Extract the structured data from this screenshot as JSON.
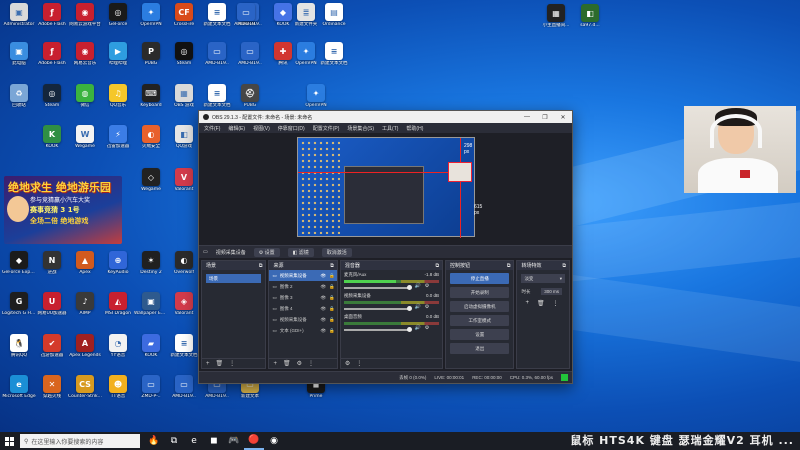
{
  "desktop": {
    "icons": [
      {
        "label": "Administrator",
        "color": "#d9d9d9",
        "glyph": "▣"
      },
      {
        "label": "Adobe Flash",
        "color": "#c8202f",
        "glyph": "ƒ"
      },
      {
        "label": "网易云游戏平台",
        "color": "#c8202f",
        "glyph": "◉"
      },
      {
        "label": "GeForce",
        "color": "#1a1a1a",
        "glyph": "◎"
      },
      {
        "label": "OpenVPN",
        "color": "#2b7de0",
        "glyph": "✦"
      },
      {
        "label": "CrossFire",
        "color": "#d94a1a",
        "glyph": "CF"
      },
      {
        "label": "新建文本文档",
        "color": "#ffffff",
        "glyph": "≡"
      },
      {
        "label": "AMD-B19..",
        "color": "#2a64c6",
        "glyph": "▭"
      },
      {
        "label": "AMD-B19..",
        "color": "#2a64c6",
        "glyph": "▭"
      },
      {
        "label": "KOOK",
        "color": "#4673e6",
        "glyph": "◆"
      },
      {
        "label": "新建文件夹",
        "color": "#e3e3e3",
        "glyph": "≣"
      },
      {
        "label": "Ordinance",
        "color": "#ffffff",
        "glyph": "▤"
      },
      {
        "label": "此电脑",
        "color": "#3a8de0",
        "glyph": "▣"
      },
      {
        "label": "Adobe Flash",
        "color": "#c8202f",
        "glyph": "ƒ"
      },
      {
        "label": "网易云音乐",
        "color": "#c8202f",
        "glyph": "◉"
      },
      {
        "label": "哔哩哔哩",
        "color": "#2e9de0",
        "glyph": "▶"
      },
      {
        "label": "PUBG",
        "color": "#2b2b2b",
        "glyph": "P"
      },
      {
        "label": "Steam",
        "color": "#111111",
        "glyph": "◎"
      },
      {
        "label": "AMD-B19..",
        "color": "#2a64c6",
        "glyph": "▭"
      },
      {
        "label": "AMD-B19..",
        "color": "#2a64c6",
        "glyph": "▭"
      },
      {
        "label": "腾讯",
        "color": "#d2362f",
        "glyph": "✚"
      },
      {
        "label": "OpenVPN",
        "color": "#2b7de0",
        "glyph": "✦"
      },
      {
        "label": "新建文本文档",
        "color": "#ffffff",
        "glyph": "≡"
      },
      {
        "label": "回收站",
        "color": "#7aa6d6",
        "glyph": "♻"
      },
      {
        "label": "Steam",
        "color": "#14263d",
        "glyph": "◎"
      },
      {
        "label": "微信",
        "color": "#3bb33f",
        "glyph": "◍"
      },
      {
        "label": "QQ音乐",
        "color": "#f5c72a",
        "glyph": "♫"
      },
      {
        "label": "Keyboard",
        "color": "#222222",
        "glyph": "⌨"
      },
      {
        "label": "OBS 游戏",
        "color": "#d9d9d9",
        "glyph": "▦"
      },
      {
        "label": "新建文本文档",
        "color": "#ffffff",
        "glyph": "≡"
      },
      {
        "label": "PUBG",
        "color": "#474747",
        "glyph": "⛑"
      },
      {
        "label": "OpenVPN",
        "color": "#2b7de0",
        "glyph": "✦"
      },
      {
        "label": "下载",
        "color": "#4a9fe6",
        "glyph": "↓"
      },
      {
        "label": "KOOK",
        "color": "#2f8f44",
        "glyph": "K"
      },
      {
        "label": "Wegame",
        "color": "#f3f3f3",
        "glyph": "W"
      },
      {
        "label": "迅雷加速器",
        "color": "#3b7de6",
        "glyph": "⚡"
      },
      {
        "label": "火绒安全",
        "color": "#e8612c",
        "glyph": "◐"
      },
      {
        "label": "QQ游戏",
        "color": "#e6e6e6",
        "glyph": "◧"
      },
      {
        "label": "Wegame",
        "color": "#222222",
        "glyph": "◇"
      },
      {
        "label": "Valorant",
        "color": "#d33b4b",
        "glyph": "V"
      },
      {
        "label": "英雄联盟",
        "color": "#1a3352",
        "glyph": "◈"
      },
      {
        "label": "腾讯会议",
        "color": "#2b7de0",
        "glyph": "☁"
      },
      {
        "label": "GeForce Experience",
        "color": "#1b1b1b",
        "glyph": "◆"
      },
      {
        "label": "逆战",
        "color": "#333333",
        "glyph": "N"
      },
      {
        "label": "Apex",
        "color": "#d25a1e",
        "glyph": "▲"
      },
      {
        "label": "KeyAudio",
        "color": "#3066d8",
        "glyph": "⊕"
      },
      {
        "label": "Destiny 2",
        "color": "#202020",
        "glyph": "✶"
      },
      {
        "label": "Overwolf",
        "color": "#2b2b2b",
        "glyph": "◐"
      },
      {
        "label": "Logitech G HUB",
        "color": "#1e1e1e",
        "glyph": "G"
      },
      {
        "label": "网易UU加速器",
        "color": "#c8202f",
        "glyph": "U"
      },
      {
        "label": "AIMP",
        "color": "#3a3a3a",
        "glyph": "♪"
      },
      {
        "label": "MSI Dragon",
        "color": "#c8202f",
        "glyph": "◭"
      },
      {
        "label": "Wallpaper Engine",
        "color": "#2e5a8e",
        "glyph": "▣"
      },
      {
        "label": "Valorant",
        "color": "#d33b4b",
        "glyph": "◈"
      },
      {
        "label": "腾讯QQ",
        "color": "#ffffff",
        "glyph": "🐧"
      },
      {
        "label": "迅游加速器",
        "color": "#d43a2a",
        "glyph": "✔"
      },
      {
        "label": "Apex Legends",
        "color": "#a02020",
        "glyph": "A"
      },
      {
        "label": "YY语音",
        "color": "#f2f2f2",
        "glyph": "◔"
      },
      {
        "label": "KOOK",
        "color": "#3d6be0",
        "glyph": "▰"
      },
      {
        "label": "新建文本文档",
        "color": "#ffffff",
        "glyph": "≡"
      },
      {
        "label": "Microsoft Edge",
        "color": "#1b8fd6",
        "glyph": "e"
      },
      {
        "label": "穿越火线",
        "color": "#d9651e",
        "glyph": "✕"
      },
      {
        "label": "Counter-Strike 2",
        "color": "#d79a1f",
        "glyph": "CS"
      },
      {
        "label": "TT语音",
        "color": "#f2b01e",
        "glyph": "☻"
      },
      {
        "label": "ZMD-P-..",
        "color": "#2a64c6",
        "glyph": "▭"
      },
      {
        "label": "AMD-B19..",
        "color": "#2a64c6",
        "glyph": "▭"
      },
      {
        "label": "AMD-B19..",
        "color": "#2a64c6",
        "glyph": "▭"
      },
      {
        "label": "新建文本",
        "color": "#d9b44a",
        "glyph": "▭"
      },
      {
        "label": "Prime",
        "color": "#1a1a1a",
        "glyph": "◼"
      }
    ],
    "top_right_icons": [
      {
        "label": "小主直播间...",
        "color": "#222222",
        "glyph": "▦"
      },
      {
        "label": "sa97.d...",
        "color": "#2c6b2c",
        "glyph": "◧"
      }
    ],
    "promo": {
      "line1": "绝地求生 绝地游乐园",
      "line2": "参与竞猜赢小汽车大奖",
      "line3": "赛事竞猜 3 1号",
      "line4": "全场二倍 绝地游戏"
    }
  },
  "obs": {
    "title": "OBS 29.1.3 - 配置文件: 未命名 - 场景: 未命名",
    "controls": {
      "minimize": "—",
      "maximize": "❐",
      "close": "✕"
    },
    "menu": [
      "文件(F)",
      "编辑(E)",
      "视图(V)",
      "停靠窗口(D)",
      "配置文件(P)",
      "场景集合(S)",
      "工具(T)",
      "帮助(H)"
    ],
    "preview": {
      "px_top": "298 px",
      "px_right": "615 px"
    },
    "source_bar": {
      "label": "视频采集设备",
      "properties": "设置",
      "filters": "滤镜",
      "deactivate": "取消激活"
    },
    "docks": {
      "scenes": {
        "title": "场景",
        "items": [
          "场景"
        ]
      },
      "sources": {
        "title": "来源",
        "items": [
          {
            "name": "视频采集设备",
            "selected": true
          },
          {
            "name": "图像 2",
            "selected": false
          },
          {
            "name": "图像 3",
            "selected": false
          },
          {
            "name": "图像 4",
            "selected": false
          },
          {
            "name": "视频采集设备",
            "selected": false
          },
          {
            "name": "文本 (GDI+)",
            "selected": false
          }
        ]
      },
      "mixer": {
        "title": "混音器",
        "channels": [
          {
            "name": "麦克风/Aux",
            "db": "-1.8 dB",
            "live": true
          },
          {
            "name": "视频采集设备",
            "db": "0.0 dB",
            "live": false
          },
          {
            "name": "桌面音频",
            "db": "0.0 dB",
            "live": false
          }
        ]
      },
      "controls": {
        "title": "控制按钮",
        "buttons": [
          {
            "label": "停止直播",
            "on": true
          },
          {
            "label": "开始录制",
            "on": false
          },
          {
            "label": "启动虚拟摄像机",
            "on": false
          },
          {
            "label": "工作室模式",
            "on": false
          },
          {
            "label": "设置",
            "on": false
          },
          {
            "label": "退出",
            "on": false
          }
        ]
      },
      "transitions": {
        "title": "转场特效",
        "type": "淡变",
        "duration_label": "时长",
        "duration": "300 ms"
      }
    },
    "status": {
      "dropped": "丢帧 0 (0.0%)",
      "live": "LIVE: 00:00:01",
      "rec": "REC: 00:00:00",
      "cpu": "CPU: 0.3%, 60.00 fps"
    }
  },
  "taskbar": {
    "search_placeholder": "在这里输入你要搜索的内容",
    "apps": [
      "🔥",
      "⧉",
      "e",
      "◼",
      "🎮",
      "🔴",
      "◉"
    ],
    "overlay_text": "鼠标 HTS4K 键盘 瑟瑞金耀V2 耳机 ..."
  }
}
